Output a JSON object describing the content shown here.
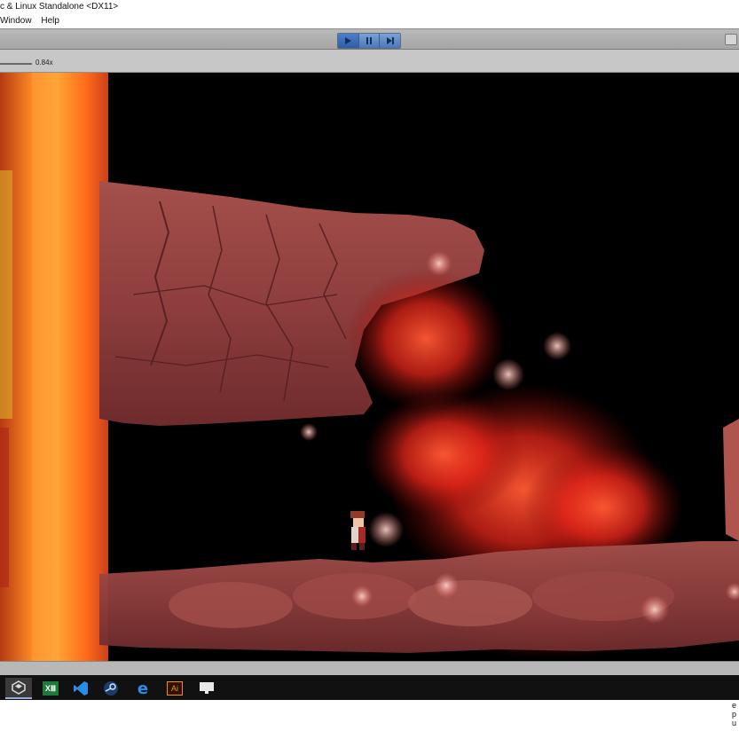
{
  "window": {
    "title": "c & Linux Standalone <DX11>",
    "menu": [
      "Window",
      "Help"
    ]
  },
  "toolbar": {
    "play_icon": "play-icon",
    "pause_icon": "pause-icon",
    "step_icon": "step-icon"
  },
  "game_view": {
    "scale_label": "0.84x"
  },
  "taskbar": {
    "apps": [
      "unity-icon",
      "excel-icon",
      "visual-studio-code-icon",
      "steam-icon",
      "edge-icon",
      "illustrator-icon",
      "display-icon"
    ],
    "excel_label": "XⅢ",
    "illustrator_label": "Ai"
  },
  "corner_text": "e\np\nu",
  "colors": {
    "lava": "#ff7a1a",
    "rock": "#8a3b3b",
    "fire": "#ff3b22",
    "toolbar_blue": "#4b77b4"
  }
}
